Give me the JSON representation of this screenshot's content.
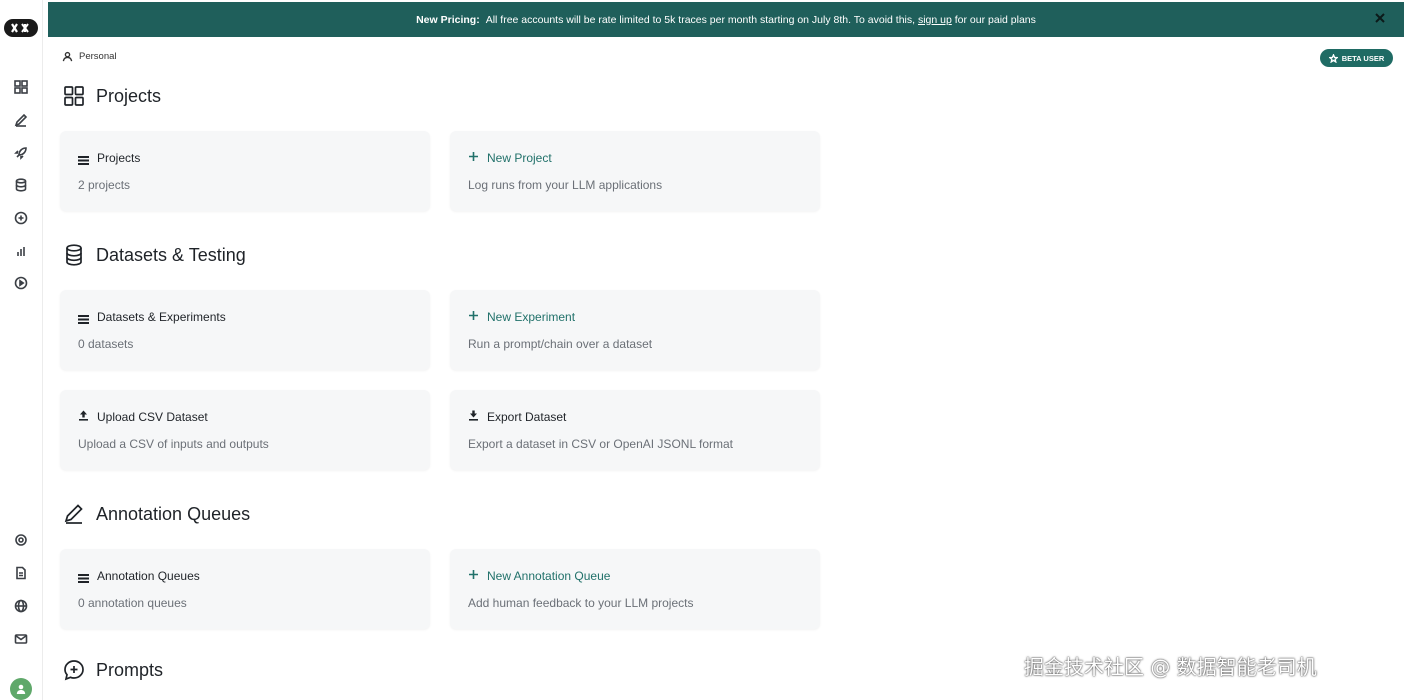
{
  "banner": {
    "label": "New Pricing:",
    "text_before": "All free accounts will be rate limited to 5k traces per month starting on July 8th. To avoid this, ",
    "link": "sign up",
    "text_after": " for our paid plans"
  },
  "workspace": "Personal",
  "beta_badge": "BETA USER",
  "sections": {
    "projects": {
      "title": "Projects",
      "cards": [
        {
          "title": "Projects",
          "subtitle": "2 projects"
        },
        {
          "title": "New Project",
          "subtitle": "Log runs from your LLM applications"
        }
      ]
    },
    "datasets": {
      "title": "Datasets & Testing",
      "cards": [
        {
          "title": "Datasets & Experiments",
          "subtitle": "0 datasets"
        },
        {
          "title": "New Experiment",
          "subtitle": "Run a prompt/chain over a dataset"
        },
        {
          "title": "Upload CSV Dataset",
          "subtitle": "Upload a CSV of inputs and outputs"
        },
        {
          "title": "Export Dataset",
          "subtitle": "Export a dataset in CSV or OpenAI JSONL format"
        }
      ]
    },
    "annotation": {
      "title": "Annotation Queues",
      "cards": [
        {
          "title": "Annotation Queues",
          "subtitle": "0 annotation queues"
        },
        {
          "title": "New Annotation Queue",
          "subtitle": "Add human feedback to your LLM projects"
        }
      ]
    },
    "prompts": {
      "title": "Prompts"
    }
  },
  "sidebar": {
    "top_icons": [
      "grid-icon",
      "pen-icon",
      "rocket-icon",
      "database-icon",
      "play-plus-icon",
      "bar-chart-icon",
      "play-circle-icon"
    ],
    "bottom_icons": [
      "settings-icon",
      "document-icon",
      "globe-icon",
      "mail-icon"
    ]
  },
  "watermark": "掘金技术社区 @ 数据智能老司机",
  "colors": {
    "banner": "#1f5f5b",
    "accent": "#21716a",
    "card_bg": "#f6f7f8"
  }
}
